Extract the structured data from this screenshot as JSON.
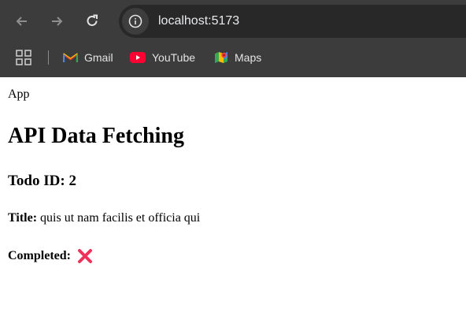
{
  "browser": {
    "url": "localhost:5173",
    "bookmarks": [
      {
        "label": "Gmail",
        "icon": "gmail-icon"
      },
      {
        "label": "YouTube",
        "icon": "youtube-icon"
      },
      {
        "label": "Maps",
        "icon": "maps-icon"
      }
    ]
  },
  "page": {
    "app_label": "App",
    "heading": "API Data Fetching",
    "todo_heading": "Todo ID: 2",
    "title_label": "Title:",
    "title_value": "quis ut nam facilis et officia qui",
    "completed_label": "Completed:",
    "completed_icon": "cross-mark-icon"
  },
  "colors": {
    "chrome_bg": "#3c3c3c",
    "address_bg": "#282828",
    "cross_color": "#f0325a"
  }
}
